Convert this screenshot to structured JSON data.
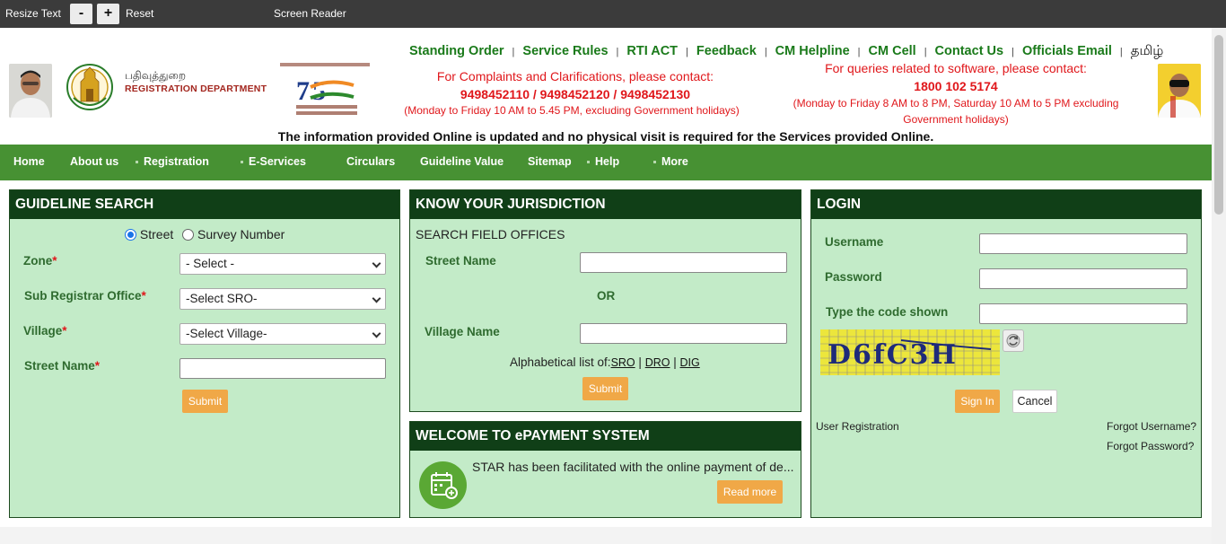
{
  "topbar": {
    "resize_text": "Resize Text",
    "decrease": "-",
    "increase": "+",
    "reset": "Reset",
    "screen_reader": "Screen Reader"
  },
  "header": {
    "dept_tamil": "பதிவுத்துறை",
    "dept_english": "REGISTRATION DEPARTMENT",
    "links": [
      "Standing Order",
      "Service Rules",
      "RTI ACT",
      "Feedback",
      "CM Helpline",
      "CM Cell",
      "Contact Us",
      "Officials Email",
      "தமிழ்"
    ],
    "complaints_title": "For Complaints and Clarifications, please contact:",
    "complaints_phones": "9498452110 / 9498452120 / 9498452130",
    "complaints_hours": "(Monday to Friday 10 AM to 5.45 PM, excluding Government holidays)",
    "software_title": "For queries related to software, please contact:",
    "software_phone": "1800 102 5174",
    "software_hours": "(Monday to Friday 8 AM to 8 PM, Saturday 10 AM to 5 PM excluding Government holidays)",
    "info_line": "The information provided Online is updated and no physical visit is required for the Services provided Online."
  },
  "nav": {
    "items": [
      "Home",
      "About us",
      "Registration",
      "E-Services",
      "Circulars",
      "Guideline Value",
      "Sitemap",
      "Help",
      "More"
    ]
  },
  "guideline": {
    "title": "GUIDELINE SEARCH",
    "radio_street": "Street",
    "radio_survey": "Survey Number",
    "zone_label": "Zone",
    "zone_value": "- Select -",
    "sro_label": "Sub Registrar Office",
    "sro_value": "-Select SRO-",
    "village_label": "Village",
    "village_value": "-Select Village-",
    "street_label": "Street Name",
    "street_value": "",
    "required": "*",
    "submit": "Submit"
  },
  "jurisdiction": {
    "title": "KNOW YOUR JURISDICTION",
    "subtitle": "SEARCH FIELD OFFICES",
    "street_label": "Street Name",
    "or": "OR",
    "village_label": "Village Name",
    "alpha_label": "Alphabetical list of:",
    "alpha_sro": "SRO",
    "alpha_dro": "DRO",
    "alpha_dig": "DIG",
    "alpha_sep": "|",
    "submit": "Submit"
  },
  "epayment": {
    "title": "WELCOME TO ePAYMENT SYSTEM",
    "text": "STAR has been facilitated with the online payment of de...",
    "read_more": "Read more",
    "icon": "calendar-payment-icon"
  },
  "login": {
    "title": "LOGIN",
    "username_label": "Username",
    "password_label": "Password",
    "code_label": "Type the code shown",
    "captcha_text": "D6fC3H",
    "sign_in": "Sign In",
    "cancel": "Cancel",
    "user_registration": "User Registration",
    "forgot_username": "Forgot Username?",
    "forgot_password": "Forgot Password?"
  },
  "colors": {
    "nav_green": "#479133",
    "panel_green": "#c3ebc8",
    "header_dark": "#103f17",
    "link_green": "#1a7a1a",
    "alert_red": "#e0171b",
    "button_orange": "#f0a847"
  }
}
